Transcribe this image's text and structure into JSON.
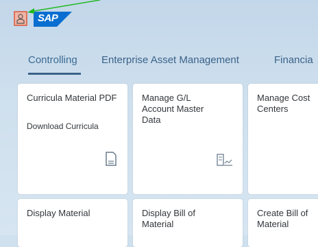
{
  "header": {
    "logo_text": "SAP",
    "user_icon": "user-icon",
    "accent_color": "#f2b4a5",
    "logo_color": "#0a6ed1"
  },
  "tabs": [
    {
      "label": "Controlling",
      "active": true
    },
    {
      "label": "Enterprise Asset Management",
      "active": false
    },
    {
      "label": "Financia",
      "active": false
    }
  ],
  "tiles": [
    {
      "title": "Curricula Material PDF",
      "subtitle": "Download Curricula",
      "icon": "document-icon"
    },
    {
      "title": "Manage G/L Account Master Data",
      "subtitle": "",
      "icon": "account-chart-icon"
    },
    {
      "title": "Manage Cost Centers",
      "subtitle": "",
      "icon": ""
    },
    {
      "title": "Display Material",
      "subtitle": "",
      "icon": ""
    },
    {
      "title": "Display Bill of Material",
      "subtitle": "",
      "icon": ""
    },
    {
      "title": "Create Bill of Material",
      "subtitle": "",
      "icon": ""
    }
  ]
}
